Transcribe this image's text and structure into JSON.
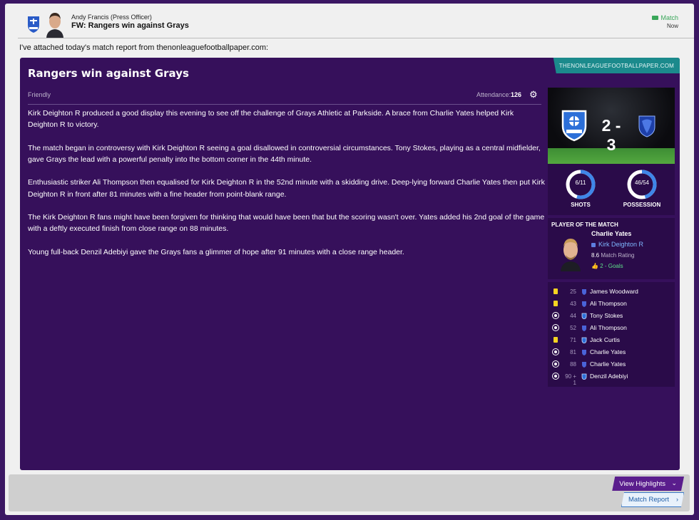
{
  "message": {
    "sender": "Andy Francis  (Press Officer)",
    "subject": "FW: Rangers win against Grays",
    "tag": "Match",
    "time": "Now",
    "intro": "I've attached today's match report from thenonleaguefootballpaper.com:"
  },
  "report": {
    "publication": "THENONLEAGUEFOOTBALLPAPER.COM",
    "headline": "Rangers win against Grays",
    "competition": "Friendly",
    "attendance_label": "Attendance:",
    "attendance_value": "126",
    "paragraphs": [
      "Kirk Deighton R produced a good display this evening to see off the challenge of Grays Athletic at Parkside. A brace from Charlie Yates helped Kirk Deighton R to victory.",
      "The match began in controversy with Kirk Deighton R seeing a goal disallowed in controversial circumstances. Tony Stokes, playing as a central midfielder, gave Grays the lead with a powerful penalty into the bottom corner in the 44th minute.",
      "Enthusiastic striker Ali Thompson then equalised for Kirk Deighton R in the 52nd minute with a skidding drive. Deep-lying forward Charlie Yates then put Kirk Deighton R in front after 81 minutes with a fine header from point-blank range.",
      "The Kirk Deighton R fans might have been forgiven for thinking that would have been that but the scoring wasn't over. Yates added his 2nd goal of the game with a deftly executed finish from close range on 88 minutes.",
      "Young full-back Denzil Adebiyi gave the Grays fans a glimmer of hope after 91 minutes with a close range header."
    ]
  },
  "match": {
    "score": "2 - 3",
    "shots_value": "6/11",
    "shots_fraction": 0.545,
    "shots_label": "SHOTS",
    "possession_value": "46/54",
    "possession_fraction": 0.46,
    "possession_label": "POSSESSION",
    "colors": {
      "ring": "#3f86e8",
      "ring_track": "#ffffff"
    }
  },
  "potm": {
    "title": "PLAYER OF THE MATCH",
    "name": "Charlie Yates",
    "club": "Kirk Deighton R",
    "rating": "8.6",
    "rating_label": "Match Rating",
    "goals": "2 - Goals"
  },
  "events": [
    {
      "type": "yellow-card",
      "minute": "25",
      "team": "home",
      "player": "James Woodward"
    },
    {
      "type": "yellow-card",
      "minute": "43",
      "team": "home",
      "player": "Ali Thompson"
    },
    {
      "type": "goal",
      "minute": "44",
      "team": "away",
      "player": "Tony Stokes"
    },
    {
      "type": "goal",
      "minute": "52",
      "team": "home",
      "player": "Ali Thompson"
    },
    {
      "type": "yellow-card",
      "minute": "71",
      "team": "away",
      "player": "Jack Curtis"
    },
    {
      "type": "goal",
      "minute": "81",
      "team": "home",
      "player": "Charlie Yates"
    },
    {
      "type": "goal",
      "minute": "88",
      "team": "home",
      "player": "Charlie Yates"
    },
    {
      "type": "goal",
      "minute": "90 + 1",
      "team": "away",
      "player": "Denzil Adebiyi"
    }
  ],
  "footer": {
    "highlights_label": "View Highlights",
    "report_label": "Match Report"
  }
}
